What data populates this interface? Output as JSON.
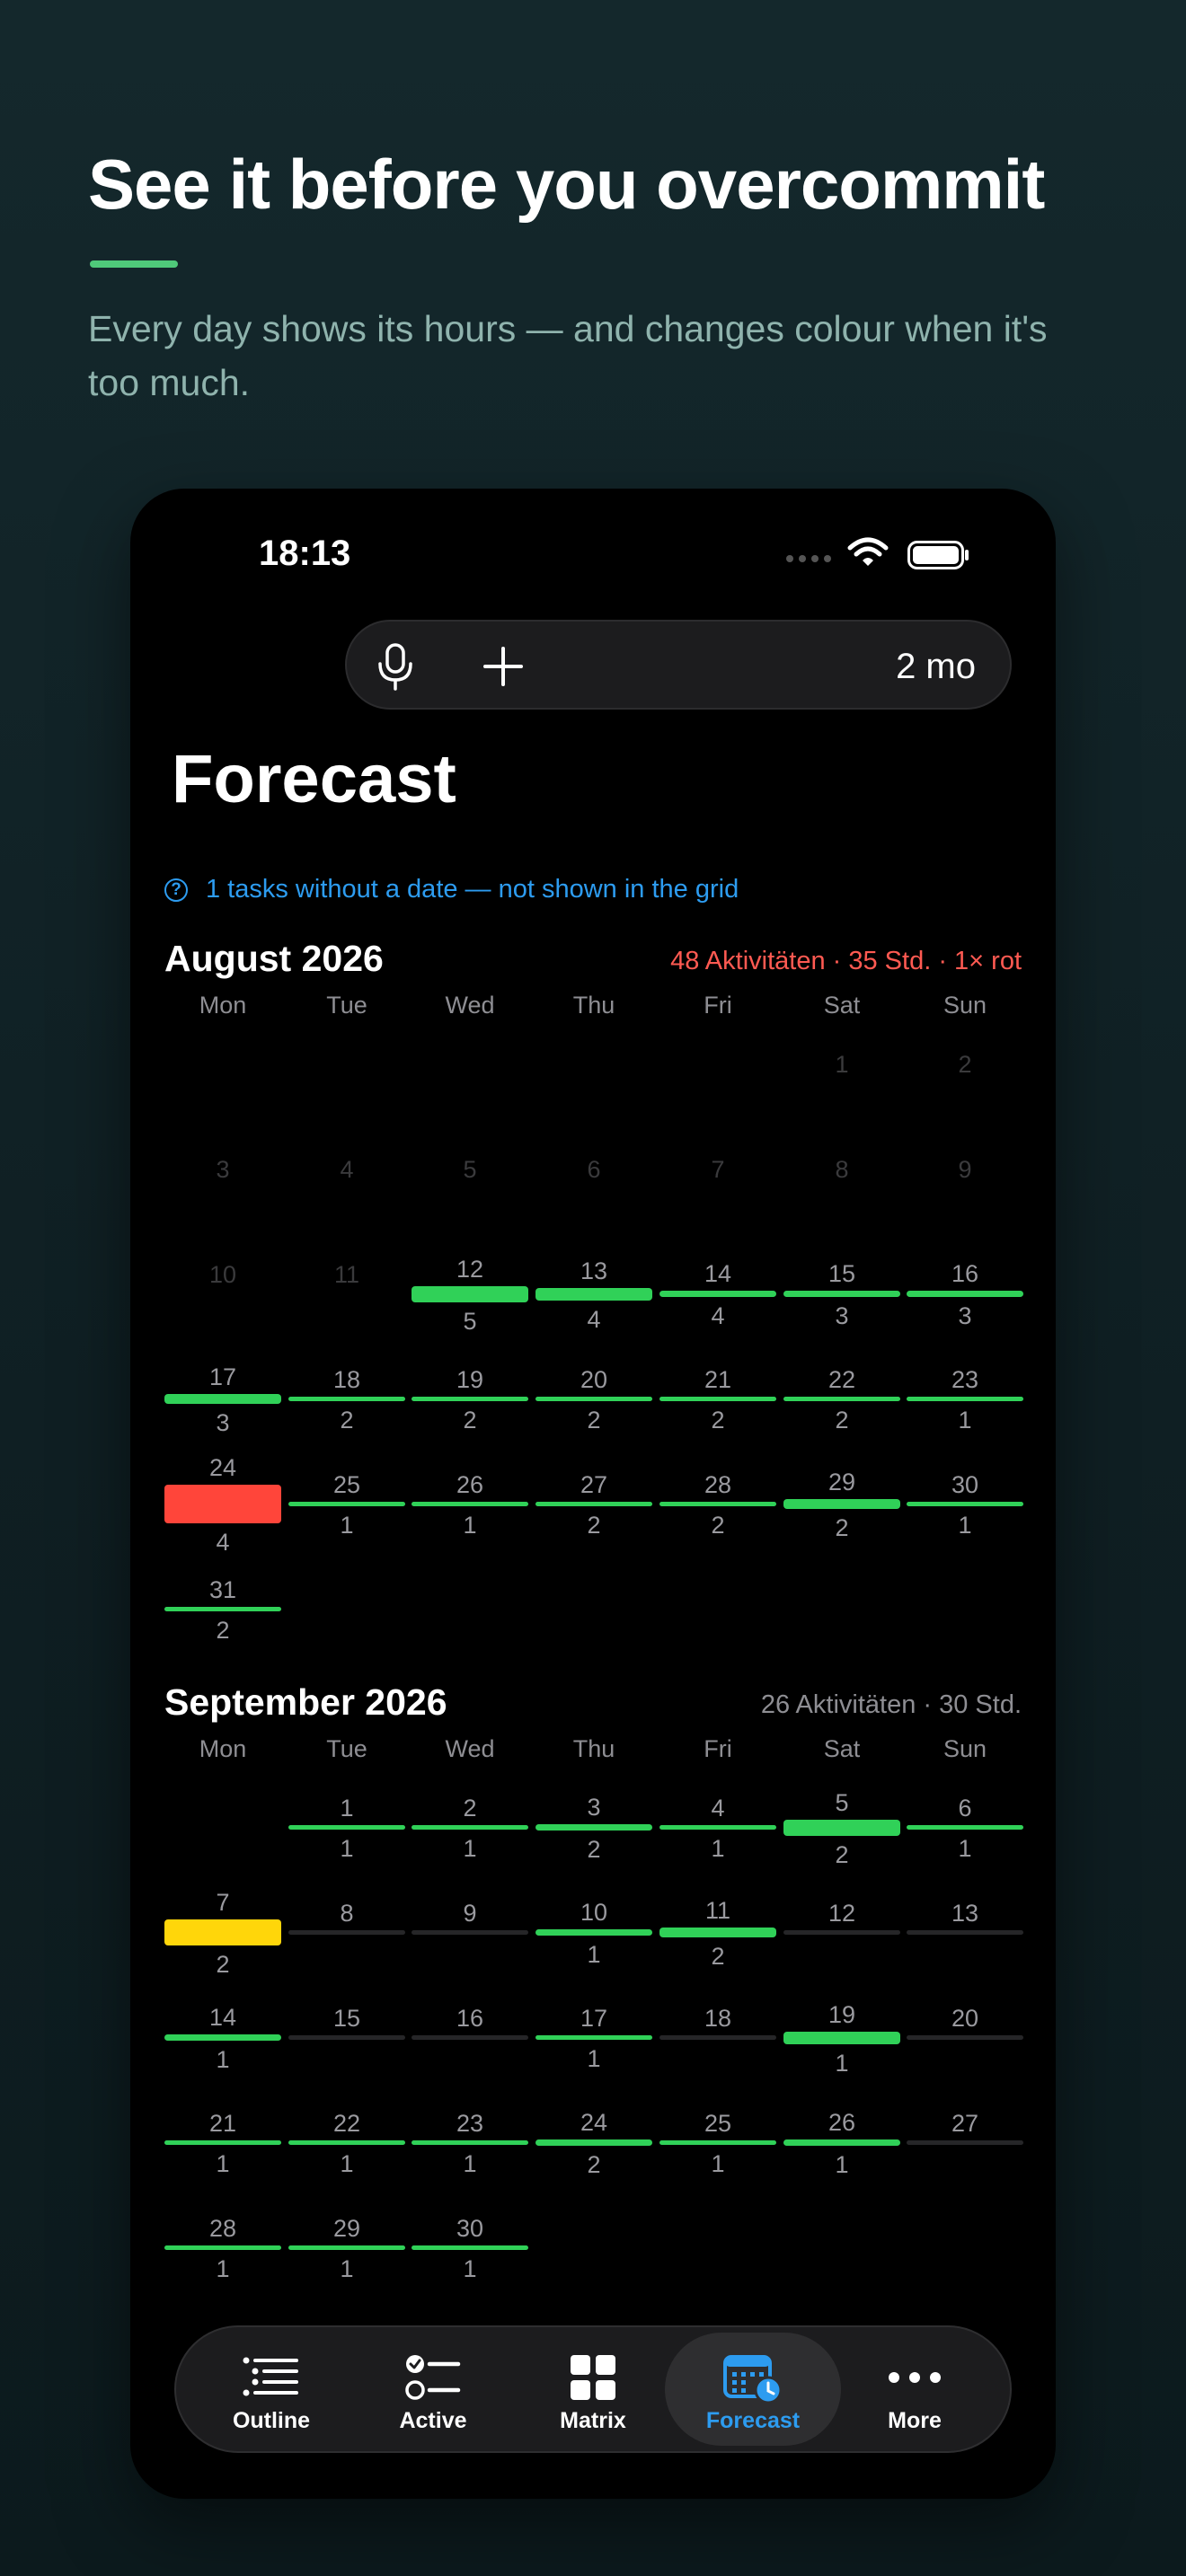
{
  "headline": "See it before you overcommit",
  "subline": "Every day shows its hours — and changes colour when it's too much.",
  "status": {
    "time": "18:13"
  },
  "toolbar": {
    "range_label": "2 mo"
  },
  "page_title": "Forecast",
  "no_date_notice": "1 tasks without a date — not shown in the grid",
  "colors": {
    "green": "#30d158",
    "yellow": "#ffd60a",
    "red": "#ff453a",
    "track": "#262628",
    "accent_blue": "#2d9cf0",
    "warning_red": "#ff5a52"
  },
  "weekdays": [
    "Mon",
    "Tue",
    "Wed",
    "Thu",
    "Fri",
    "Sat",
    "Sun"
  ],
  "months": [
    {
      "title": "August 2026",
      "summary": "48 Aktivitäten · 35 Std. · 1× rot",
      "summary_color": "#ff5a52",
      "weeks": [
        [
          null,
          null,
          null,
          null,
          null,
          {
            "d": "1",
            "faded": true
          },
          {
            "d": "2",
            "faded": true
          }
        ],
        [
          {
            "d": "3",
            "faded": true
          },
          {
            "d": "4",
            "faded": true
          },
          {
            "d": "5",
            "faded": true
          },
          {
            "d": "6",
            "faded": true
          },
          {
            "d": "7",
            "faded": true
          },
          {
            "d": "8",
            "faded": true
          },
          {
            "d": "9",
            "faded": true
          }
        ],
        [
          {
            "d": "10",
            "faded": true
          },
          {
            "d": "11",
            "faded": true
          },
          {
            "d": "12",
            "h": "5",
            "lvl": "green",
            "load": 5
          },
          {
            "d": "13",
            "h": "4",
            "lvl": "green",
            "load": 4
          },
          {
            "d": "14",
            "h": "4",
            "lvl": "green",
            "load": 2
          },
          {
            "d": "15",
            "h": "3",
            "lvl": "green",
            "load": 2
          },
          {
            "d": "16",
            "h": "3",
            "lvl": "green",
            "load": 2
          }
        ],
        [
          {
            "d": "17",
            "h": "3",
            "lvl": "green",
            "load": 3
          },
          {
            "d": "18",
            "h": "2",
            "lvl": "green",
            "load": 1
          },
          {
            "d": "19",
            "h": "2",
            "lvl": "green",
            "load": 1
          },
          {
            "d": "20",
            "h": "2",
            "lvl": "green",
            "load": 1
          },
          {
            "d": "21",
            "h": "2",
            "lvl": "green",
            "load": 1
          },
          {
            "d": "22",
            "h": "2",
            "lvl": "green",
            "load": 1
          },
          {
            "d": "23",
            "h": "1",
            "lvl": "green",
            "load": 1
          }
        ],
        [
          {
            "d": "24",
            "h": "4",
            "lvl": "red",
            "load": 12
          },
          {
            "d": "25",
            "h": "1",
            "lvl": "green",
            "load": 1
          },
          {
            "d": "26",
            "h": "1",
            "lvl": "green",
            "load": 1
          },
          {
            "d": "27",
            "h": "2",
            "lvl": "green",
            "load": 1
          },
          {
            "d": "28",
            "h": "2",
            "lvl": "green",
            "load": 1
          },
          {
            "d": "29",
            "h": "2",
            "lvl": "green",
            "load": 3
          },
          {
            "d": "30",
            "h": "1",
            "lvl": "green",
            "load": 1
          }
        ],
        [
          {
            "d": "31",
            "h": "2",
            "lvl": "green",
            "load": 1
          },
          null,
          null,
          null,
          null,
          null,
          null
        ]
      ]
    },
    {
      "title": "September 2026",
      "summary": "26 Aktivitäten · 30 Std.",
      "summary_color": "#8e8e93",
      "weeks": [
        [
          null,
          {
            "d": "1",
            "h": "1",
            "lvl": "green",
            "load": 1
          },
          {
            "d": "2",
            "h": "1",
            "lvl": "green",
            "load": 1
          },
          {
            "d": "3",
            "h": "2",
            "lvl": "green",
            "load": 2
          },
          {
            "d": "4",
            "h": "1",
            "lvl": "green",
            "load": 1
          },
          {
            "d": "5",
            "h": "2",
            "lvl": "green",
            "load": 5
          },
          {
            "d": "6",
            "h": "1",
            "lvl": "green",
            "load": 1
          }
        ],
        [
          {
            "d": "7",
            "h": "2",
            "lvl": "yellow",
            "load": 8
          },
          {
            "d": "8"
          },
          {
            "d": "9"
          },
          {
            "d": "10",
            "h": "1",
            "lvl": "green",
            "load": 2
          },
          {
            "d": "11",
            "h": "2",
            "lvl": "green",
            "load": 3
          },
          {
            "d": "12"
          },
          {
            "d": "13"
          }
        ],
        [
          {
            "d": "14",
            "h": "1",
            "lvl": "green",
            "load": 2
          },
          {
            "d": "15"
          },
          {
            "d": "16"
          },
          {
            "d": "17",
            "h": "1",
            "lvl": "green",
            "load": 1
          },
          {
            "d": "18"
          },
          {
            "d": "19",
            "h": "1",
            "lvl": "green",
            "load": 4
          },
          {
            "d": "20"
          }
        ],
        [
          {
            "d": "21",
            "h": "1",
            "lvl": "green",
            "load": 1
          },
          {
            "d": "22",
            "h": "1",
            "lvl": "green",
            "load": 1
          },
          {
            "d": "23",
            "h": "1",
            "lvl": "green",
            "load": 1
          },
          {
            "d": "24",
            "h": "2",
            "lvl": "green",
            "load": 2
          },
          {
            "d": "25",
            "h": "1",
            "lvl": "green",
            "load": 1
          },
          {
            "d": "26",
            "h": "1",
            "lvl": "green",
            "load": 2
          },
          {
            "d": "27"
          }
        ],
        [
          {
            "d": "28",
            "h": "1",
            "lvl": "green",
            "load": 1
          },
          {
            "d": "29",
            "h": "1",
            "lvl": "green",
            "load": 1
          },
          {
            "d": "30",
            "h": "1",
            "lvl": "green",
            "load": 1
          },
          null,
          null,
          null,
          null
        ]
      ]
    }
  ],
  "tabs": [
    {
      "label": "Outline",
      "icon": "outline-list-icon",
      "active": false
    },
    {
      "label": "Active",
      "icon": "active-checklist-icon",
      "active": false
    },
    {
      "label": "Matrix",
      "icon": "matrix-grid-icon",
      "active": false
    },
    {
      "label": "Forecast",
      "icon": "forecast-calendar-icon",
      "active": true
    },
    {
      "label": "More",
      "icon": "more-dots-icon",
      "active": false
    }
  ]
}
